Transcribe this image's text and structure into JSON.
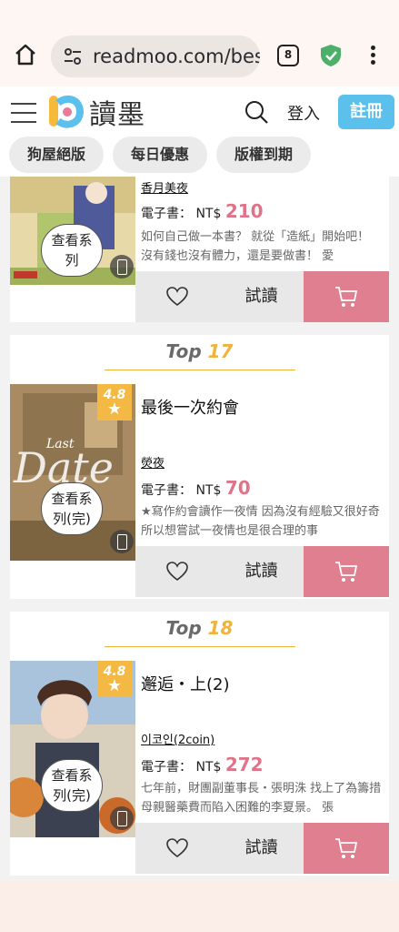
{
  "browser": {
    "url": "readmoo.com/bes",
    "tab_count": "8"
  },
  "header": {
    "logo_text": "讀墨",
    "login_label": "登入",
    "register_label": "註冊"
  },
  "chips": [
    "狗屋絕版",
    "每日優惠",
    "版權到期"
  ],
  "colors": {
    "accent_pink": "#e0738a",
    "brand_blue": "#5bc0eb",
    "rank_gold": "#f0b33c"
  },
  "books": [
    {
      "author": "香月美夜",
      "price_prefix": "電子書：",
      "currency": "NT$",
      "price": "210",
      "description": "如何自己做一本書？ 就從「造紙」開始吧！ 沒有錢也沒有體力，還是要做書！ 愛",
      "series_badge": "查看系列",
      "try_label": "試讀"
    },
    {
      "rank_prefix": "Top",
      "rank": "17",
      "rating": "4.8",
      "title": "最後一次約會",
      "author": "熒夜",
      "price_prefix": "電子書：",
      "currency": "NT$",
      "price": "70",
      "description": "★寫作約會讀作一夜情 因為沒有經驗又很好奇所以想嘗試一夜情也是很合理的事",
      "series_badge": "查看系列(完)",
      "try_label": "試讀"
    },
    {
      "rank_prefix": "Top",
      "rank": "18",
      "rating": "4.8",
      "title": "邂逅・上(2)",
      "author": "이코인(2coin)",
      "price_prefix": "電子書：",
      "currency": "NT$",
      "price": "272",
      "description": "七年前，財團副董事長・張明洙 找上了為籌措母親醫藥費而陷入困難的李夏景。 張",
      "series_badge": "查看系列(完)",
      "try_label": "試讀"
    }
  ]
}
